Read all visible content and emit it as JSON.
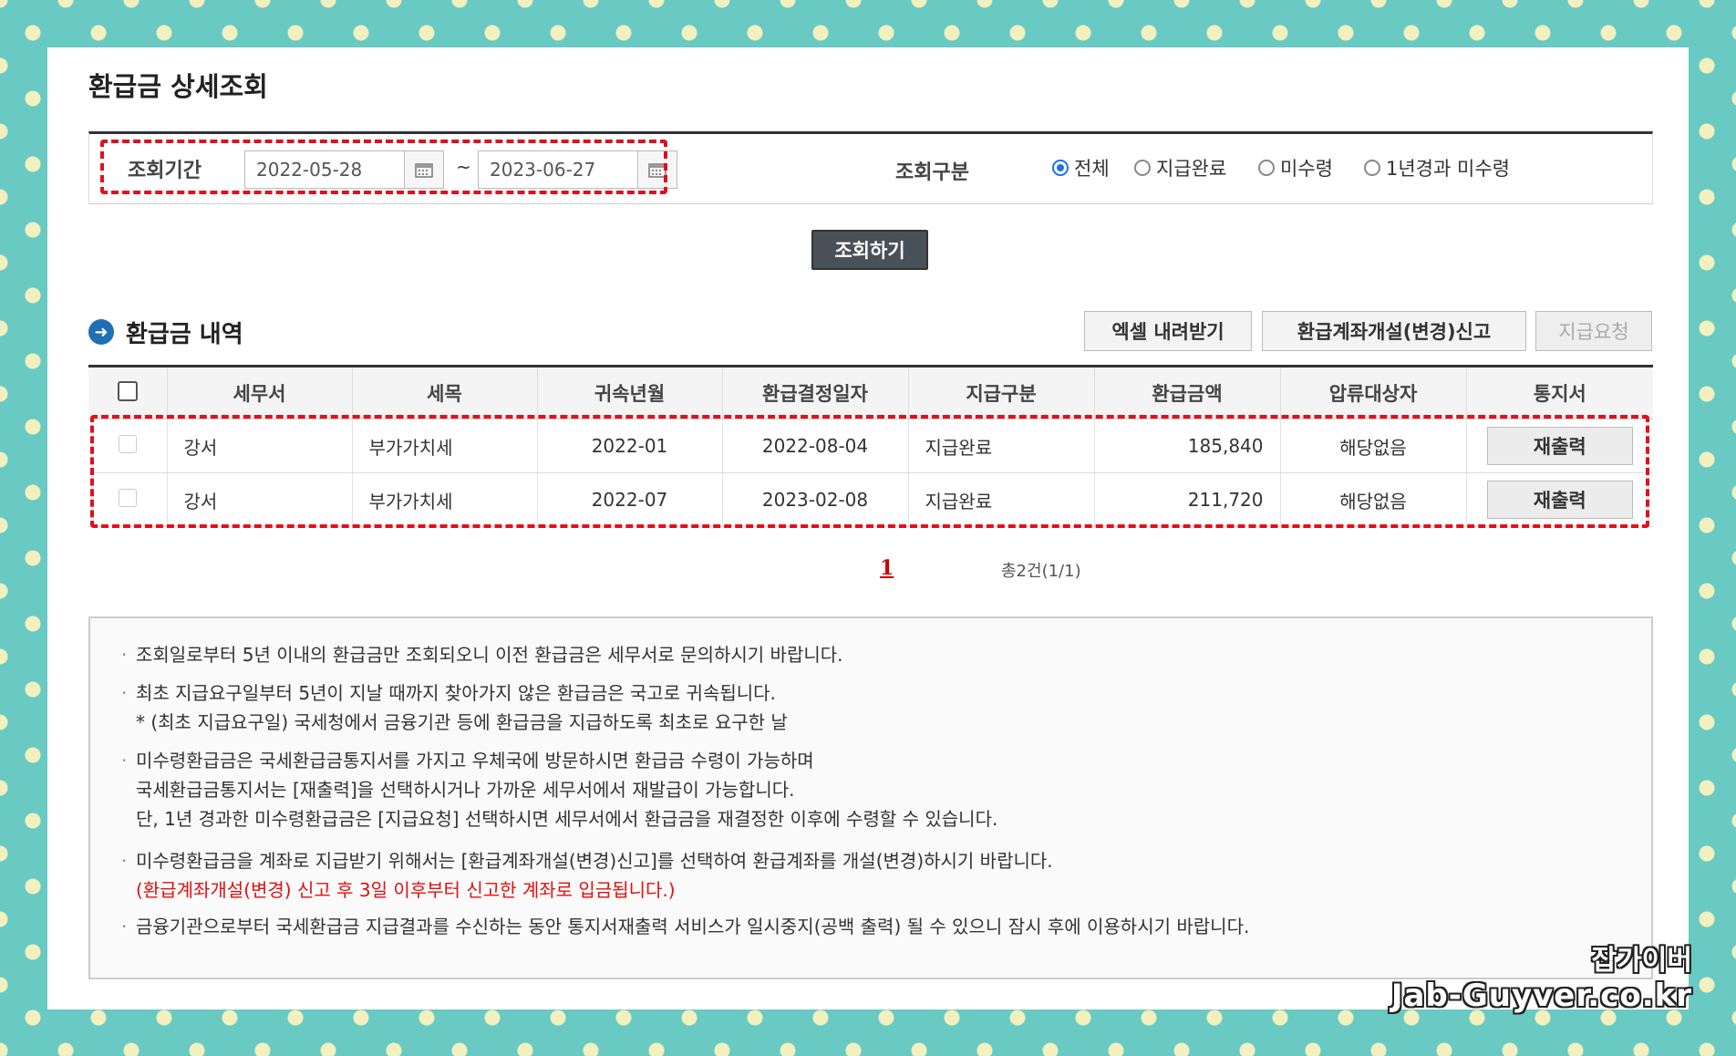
{
  "page": {
    "title": "환급금 상세조회"
  },
  "search": {
    "period_label": "조회기간",
    "start_date": "2022-05-28",
    "end_date": "2023-06-27",
    "separator": "~",
    "type_label": "조회구분",
    "options": [
      "전체",
      "지급완료",
      "미수령",
      "1년경과 미수령"
    ],
    "selected_option": "전체",
    "button_label": "조회하기"
  },
  "section": {
    "title": "환급금 내역",
    "buttons": {
      "excel": "엑셀 내려받기",
      "account": "환급계좌개설(변경)신고",
      "request": "지급요청"
    }
  },
  "table": {
    "headers": [
      "세무서",
      "세목",
      "귀속년월",
      "환급결정일자",
      "지급구분",
      "환급금액",
      "압류대상자",
      "통지서"
    ],
    "rows": [
      {
        "office": "강서",
        "tax": "부가가치세",
        "period": "2022-01",
        "date": "2022-08-04",
        "status": "지급완료",
        "amount": "185,840",
        "seizure": "해당없음",
        "action": "재출력"
      },
      {
        "office": "강서",
        "tax": "부가가치세",
        "period": "2022-07",
        "date": "2023-02-08",
        "status": "지급완료",
        "amount": "211,720",
        "seizure": "해당없음",
        "action": "재출력"
      }
    ]
  },
  "pagination": {
    "current": "1",
    "total": "총2건(1/1)"
  },
  "notices": {
    "n1": "조회일로부터 5년 이내의 환급금만 조회되오니 이전 환급금은 세무서로 문의하시기 바랍니다.",
    "n2": "최초 지급요구일부터 5년이 지날 때까지 찾아가지 않은 환급금은 국고로 귀속됩니다.",
    "n2_sub": "* (최초 지급요구일) 국세청에서 금융기관 등에 환급금을 지급하도록 최초로 요구한 날",
    "n3_1": "미수령환급금은 국세환급금통지서를 가지고 우체국에 방문하시면 환급금 수령이 가능하며",
    "n3_2": "국세환급금통지서는 [재출력]을 선택하시거나 가까운 세무서에서 재발급이 가능합니다.",
    "n3_3": "단, 1년 경과한 미수령환급금은 [지급요청] 선택하시면 세무서에서 환급금을 재결정한 이후에 수령할 수 있습니다.",
    "n4_1": "미수령환급금을 계좌로 지급받기 위해서는 [환급계좌개설(변경)신고]를 선택하여 환급계좌를 개설(변경)하시기 바랍니다.",
    "n4_2": "(환급계좌개설(변경) 신고 후 3일 이후부터 신고한 계좌로 입금됩니다.)",
    "n5": "금융기관으로부터 국세환급금 지급결과를 수신하는 동안 통지서재출력 서비스가 일시중지(공백 출력) 될 수 있으니 잠시 후에 이용하시기 바랍니다."
  },
  "watermark": {
    "line1": "잡가이버",
    "line2": "Jab-Guyver.co.kr"
  },
  "colors": {
    "background": "#69c9c3",
    "dots": "#f3f0c0",
    "highlight": "#e0101c",
    "radio_selected": "#1a73e8",
    "notice_red": "#e01010"
  }
}
